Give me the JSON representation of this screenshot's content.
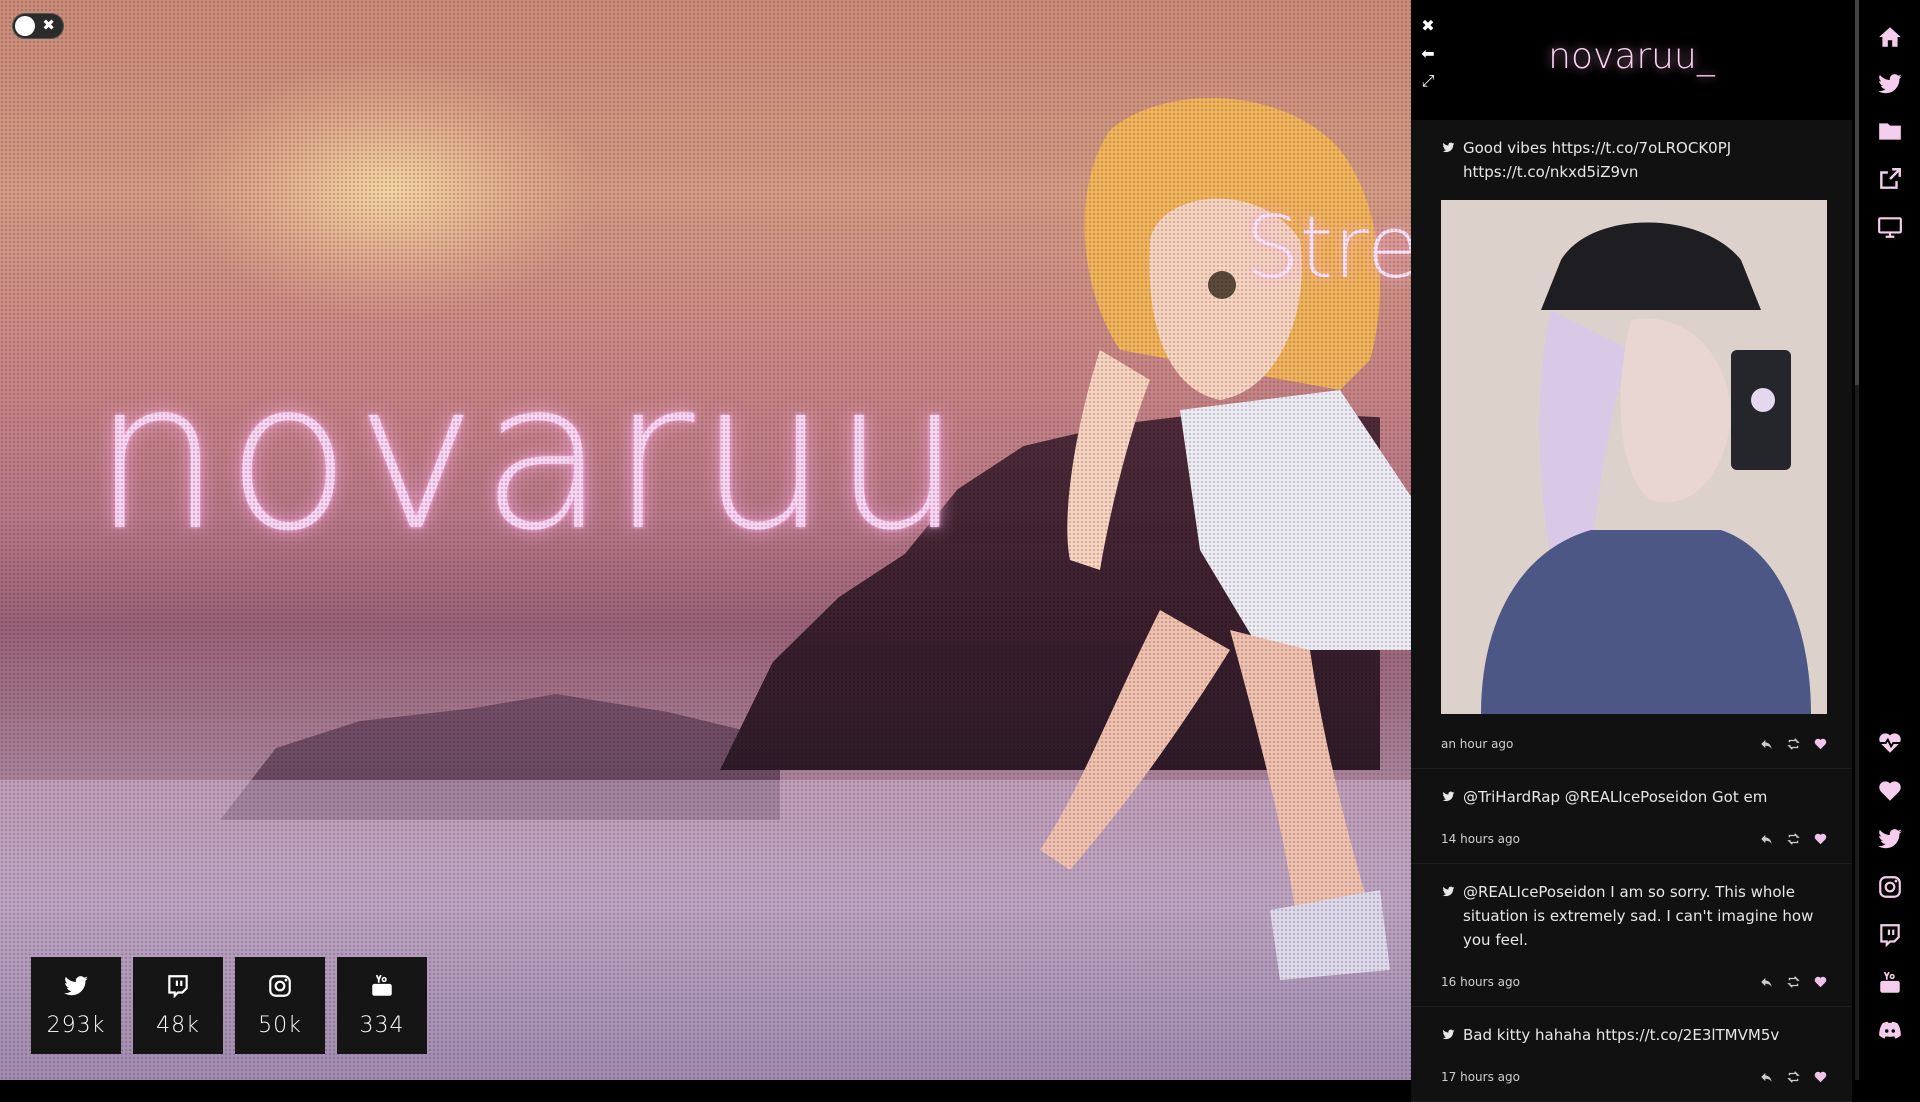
{
  "hero": {
    "name": "novaruu",
    "stream_word": "Strea"
  },
  "toggle": {
    "close_glyph": "✖"
  },
  "stats": [
    {
      "icon": "twitter-icon",
      "value": "293k"
    },
    {
      "icon": "twitch-icon",
      "value": "48k"
    },
    {
      "icon": "instagram-icon",
      "value": "50k"
    },
    {
      "icon": "youtube-icon",
      "value": "334"
    }
  ],
  "panel": {
    "title": "novaruu_",
    "controls": [
      "close-icon",
      "back-icon",
      "expand-icon"
    ],
    "tweets": [
      {
        "text": "Good vibes https://t.co/7oLROCK0PJ https://t.co/nkxd5iZ9vn",
        "time": "an hour ago",
        "has_photo": true
      },
      {
        "text": "@TriHardRap @REALIcePoseidon Got em",
        "time": "14 hours ago"
      },
      {
        "text": "@REALIcePoseidon I am so sorry. This whole situation is extremely sad. I can't imagine how you feel.",
        "time": "16 hours ago"
      },
      {
        "text": "Bad kitty hahaha https://t.co/2E3lTMVM5v",
        "time": "17 hours ago"
      }
    ]
  },
  "rail": {
    "top": [
      "home-icon",
      "twitter-icon",
      "folder-icon",
      "external-link-icon",
      "monitor-icon"
    ],
    "bottom": [
      "heartbeat-icon",
      "heart-icon",
      "twitter-icon",
      "instagram-icon",
      "twitch-icon",
      "youtube-icon",
      "discord-icon"
    ]
  },
  "colors": {
    "accent": "#f8d3f2",
    "panel_bg": "#111111"
  }
}
